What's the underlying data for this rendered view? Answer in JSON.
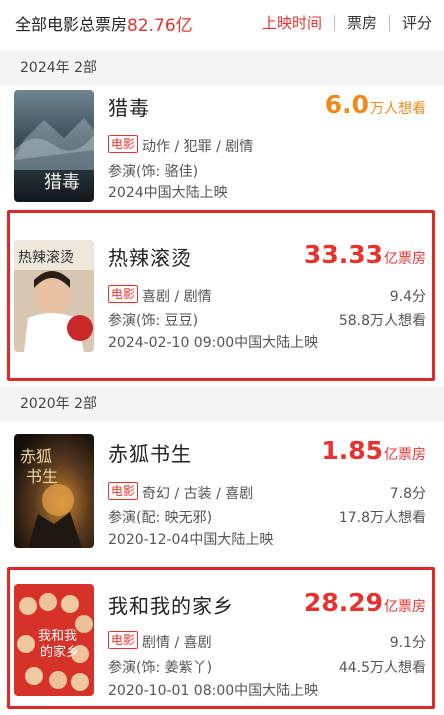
{
  "header": {
    "title": "全部电影总票房",
    "total": "82.76亿",
    "tabs": [
      "上映时间",
      "票房",
      "评分"
    ]
  },
  "sections": [
    {
      "label": "2024年  2部"
    },
    {
      "label": "2020年  2部"
    }
  ],
  "movies": [
    {
      "title": "猎毒",
      "metric_value": "6.0",
      "metric_unit": "万人想看",
      "tag": "电影",
      "genres": "动作 / 犯罪 / 剧情",
      "role": "参演(饰:  骆佳)",
      "release": "2024中国大陆上映",
      "rating": "",
      "wants": ""
    },
    {
      "title": "热辣滚烫",
      "metric_value": "33.33",
      "metric_unit": "亿票房",
      "tag": "电影",
      "genres": "喜剧 / 剧情",
      "role": "参演(饰:  豆豆)",
      "release": "2024-02-10 09:00中国大陆上映",
      "rating": "9.4分",
      "wants": "58.8万人想看"
    },
    {
      "title": "赤狐书生",
      "metric_value": "1.85",
      "metric_unit": "亿票房",
      "tag": "电影",
      "genres": "奇幻 / 古装 / 喜剧",
      "role": "参演(配:  映无邪)",
      "release": "2020-12-04中国大陆上映",
      "rating": "7.8分",
      "wants": "17.8万人想看"
    },
    {
      "title": "我和我的家乡",
      "metric_value": "28.29",
      "metric_unit": "亿票房",
      "tag": "电影",
      "genres": "剧情 / 喜剧",
      "role": "参演(饰:  姜紫丫)",
      "release": "2020-10-01 08:00中国大陆上映",
      "rating": "9.1分",
      "wants": "44.5万人想看"
    }
  ],
  "colors": {
    "accent": "#e5342f",
    "orange": "#f08a1d",
    "highlight_box": "#e32727"
  }
}
